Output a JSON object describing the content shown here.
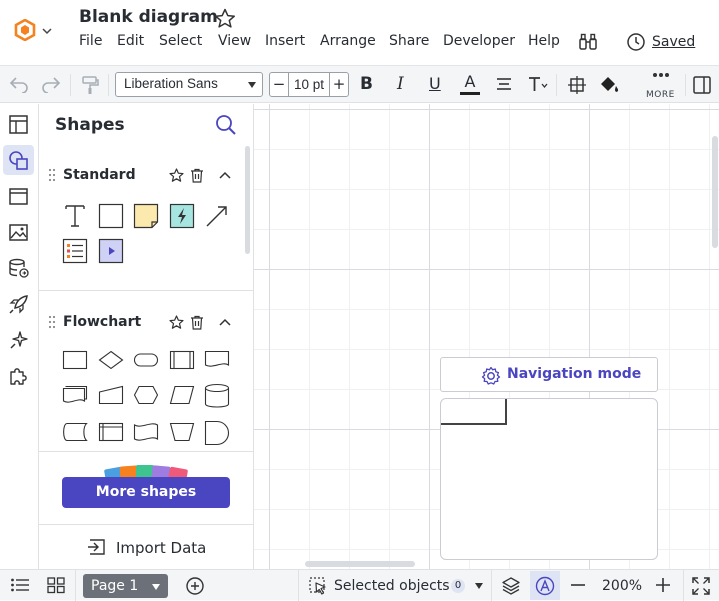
{
  "header": {
    "title": "Blank diagram",
    "menu": [
      "File",
      "Edit",
      "Select",
      "View",
      "Insert",
      "Arrange",
      "Share",
      "Developer",
      "Help"
    ],
    "saved_label": "Saved"
  },
  "toolbar": {
    "font_family_value": "Liberation Sans",
    "font_size_value": "10 pt",
    "size_minus": "−",
    "size_plus": "+",
    "bold": "B",
    "italic": "I",
    "underline": "U",
    "text_color": "A",
    "more_label": "MORE"
  },
  "panel": {
    "title": "Shapes",
    "libraries": [
      {
        "name": "Standard"
      },
      {
        "name": "Flowchart"
      }
    ],
    "more_shapes_label": "More shapes",
    "import_label": "Import Data"
  },
  "canvas": {
    "navigation_mode_label": "Navigation mode"
  },
  "bottom": {
    "page_label": "Page 1",
    "selected_label": "Selected objects",
    "selected_count": "0",
    "zoom_value": "200%"
  },
  "colors": {
    "accent": "#4a46c1",
    "logo_orange": "#f5821f",
    "rail_active": "#dfe4f5"
  }
}
